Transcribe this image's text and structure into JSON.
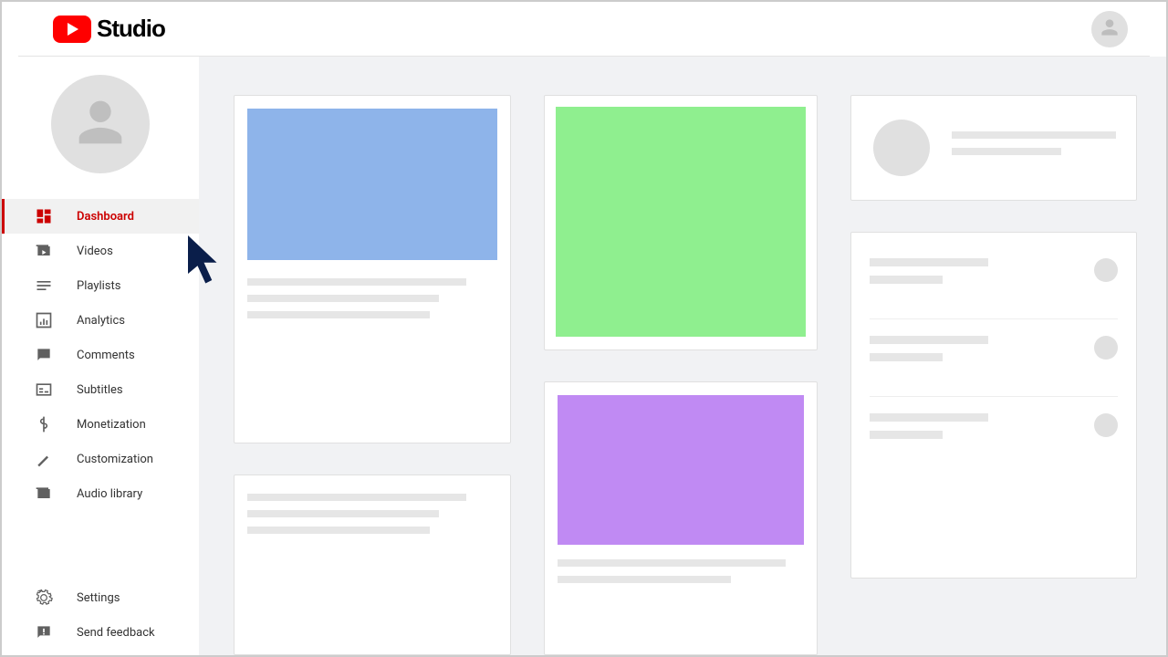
{
  "header": {
    "brand": "Studio"
  },
  "sidebar": {
    "items": [
      {
        "label": "Dashboard",
        "icon": "dashboard"
      },
      {
        "label": "Videos",
        "icon": "videos"
      },
      {
        "label": "Playlists",
        "icon": "playlists"
      },
      {
        "label": "Analytics",
        "icon": "analytics"
      },
      {
        "label": "Comments",
        "icon": "comments"
      },
      {
        "label": "Subtitles",
        "icon": "subtitles"
      },
      {
        "label": "Monetization",
        "icon": "dollar"
      },
      {
        "label": "Customization",
        "icon": "wand"
      },
      {
        "label": "Audio library",
        "icon": "audio"
      }
    ],
    "bottom": [
      {
        "label": "Settings",
        "icon": "gear"
      },
      {
        "label": "Send feedback",
        "icon": "feedback"
      }
    ]
  },
  "dashboard": {
    "card_colors": {
      "blue": "#8eb4ea",
      "green": "#8fef8f",
      "purple": "#c08af3"
    }
  }
}
